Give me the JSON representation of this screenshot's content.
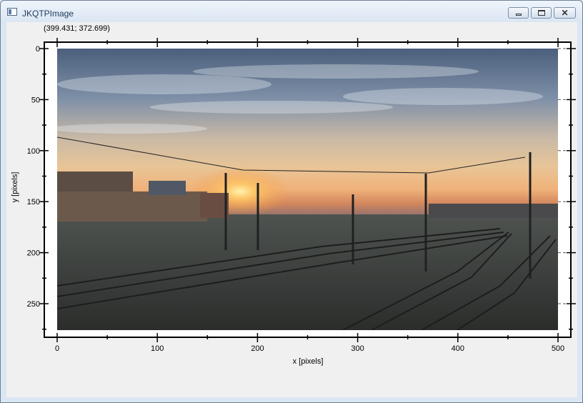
{
  "window": {
    "title": "JKQTPImage",
    "buttons": {
      "minimize": "minimize",
      "maximize": "maximize",
      "close": "close"
    }
  },
  "plot": {
    "coordinate_readout": "(399.431; 372.699)",
    "x_axis_label": "x [pixels]",
    "y_axis_label": "y [pixels]",
    "x_ticks": [
      "0",
      "100",
      "200",
      "300",
      "400",
      "500"
    ],
    "y_ticks": [
      "0",
      "50",
      "100",
      "150",
      "200",
      "250"
    ],
    "x_range": [
      0,
      500
    ],
    "y_range": [
      0,
      285
    ],
    "image_extent": [
      0,
      500,
      0,
      280
    ],
    "image_content": "sunset over railway tracks"
  }
}
